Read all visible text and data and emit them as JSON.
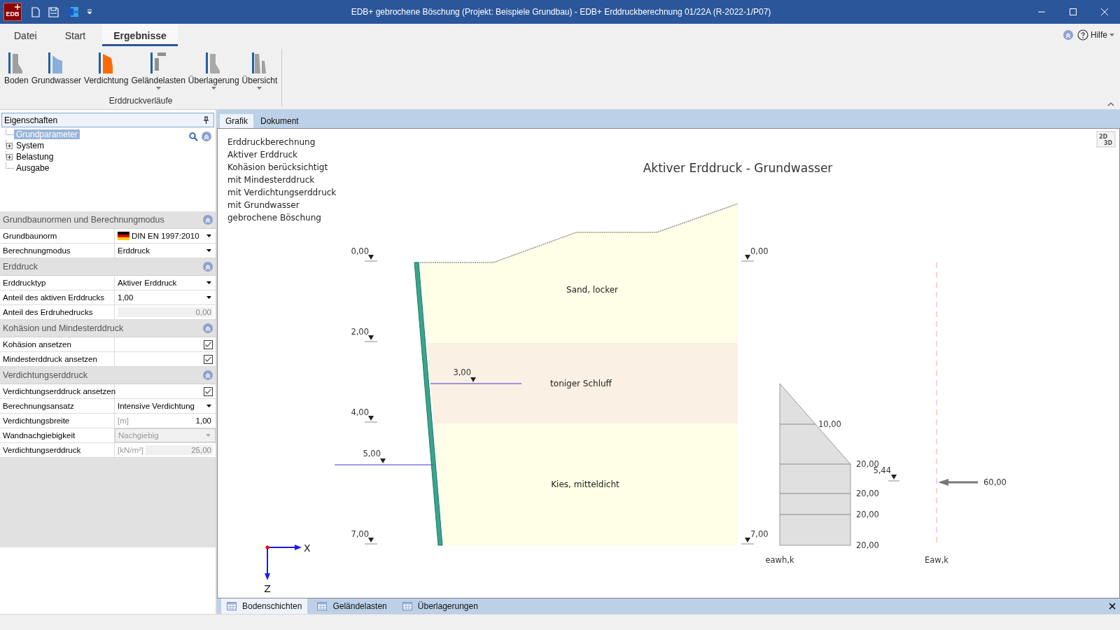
{
  "window": {
    "title": "EDB+ gebrochene Böschung (Projekt: Beispiele Grundbau) - EDB+ Erddruckberechnung 01/22A (R-2022-1/P07)",
    "logo": "EDB"
  },
  "menu_tabs": [
    {
      "label": "Datei",
      "selected": false
    },
    {
      "label": "Start",
      "selected": false
    },
    {
      "label": "Ergebnisse",
      "selected": true
    }
  ],
  "help": {
    "label": "Hilfe"
  },
  "ribbon": {
    "buttons": [
      {
        "label": "Boden",
        "dropdown": false
      },
      {
        "label": "Grundwasser",
        "dropdown": false
      },
      {
        "label": "Verdichtung",
        "dropdown": false
      },
      {
        "label": "Geländelasten",
        "dropdown": true
      },
      {
        "label": "Überlagerung",
        "dropdown": true
      },
      {
        "label": "Übersicht",
        "dropdown": true
      }
    ],
    "group": "Erddruckverläufe"
  },
  "properties": {
    "title": "Eigenschaften",
    "tree": [
      {
        "label": "Grundparameter",
        "selected": true,
        "kind": "leaf"
      },
      {
        "label": "System",
        "selected": false,
        "kind": "collapsed"
      },
      {
        "label": "Belastung",
        "selected": false,
        "kind": "collapsed"
      },
      {
        "label": "Ausgabe",
        "selected": false,
        "kind": "leaf"
      }
    ],
    "sections": [
      {
        "title": "Grundbaunormen und Berechnungmodus",
        "rows": [
          {
            "label": "Grundbaunorm",
            "kind": "flag_dropdown",
            "value": "DIN EN 1997:2010",
            "disabled": false
          },
          {
            "label": "Berechnungmodus",
            "kind": "dropdown",
            "value": "Erddruck",
            "disabled": false
          }
        ]
      },
      {
        "title": "Erddruck",
        "rows": [
          {
            "label": "Erddrucktyp",
            "kind": "dropdown",
            "value": "Aktiver Erddruck",
            "disabled": false
          },
          {
            "label": "Anteil des aktiven Erddrucks",
            "kind": "dropdown",
            "value": "1,00",
            "disabled": false
          },
          {
            "label": "Anteil des Erdruhedrucks",
            "kind": "number",
            "value": "0,00",
            "disabled": true
          }
        ]
      },
      {
        "title": "Kohäsion und Mindesterddruck",
        "rows": [
          {
            "label": "Kohäsion ansetzen",
            "kind": "checkbox",
            "checked": true
          },
          {
            "label": "Mindesterddruck ansetzen",
            "kind": "checkbox",
            "checked": true
          }
        ]
      },
      {
        "title": "Verdichtungserddruck",
        "rows": [
          {
            "label": "Verdichtungserddruck ansetzen",
            "kind": "checkbox",
            "checked": true
          },
          {
            "label": "Berechnungsansatz",
            "kind": "dropdown",
            "value": "Intensive Verdichtung",
            "disabled": false
          },
          {
            "label": "Verdichtungsbreite",
            "kind": "number",
            "unit": "[m]",
            "value": "1,00",
            "disabled": false
          },
          {
            "label": "Wandnachgiebigkeit",
            "kind": "dropdown",
            "value": "Nachgiebig",
            "disabled": true
          },
          {
            "label": "Verdichtungserddruck",
            "kind": "number",
            "unit": "[kN/m²]",
            "value": "25,00",
            "disabled": true
          }
        ]
      }
    ]
  },
  "view_tabs": [
    {
      "label": "Grafik",
      "selected": true
    },
    {
      "label": "Dokument",
      "selected": false
    }
  ],
  "graphic": {
    "view_mode": [
      "2D",
      "3D"
    ],
    "info_lines": [
      "Erddruckberechnung",
      "Aktiver Erddruck",
      "Kohäsion berücksichtigt",
      "mit Mindesterddruck",
      "mit Verdichtungserddruck",
      "mit Grundwasser",
      "gebrochene Böschung"
    ],
    "title": "Aktiver Erddruck - Grundwasser",
    "layers": [
      {
        "name": "Sand, locker",
        "color": "#fffee6"
      },
      {
        "name": "toniger Schluff",
        "color": "#faf0e3"
      },
      {
        "name": "Kies, mitteldicht",
        "color": "#fffee6"
      }
    ],
    "left_levels": [
      "0,00",
      "2,00",
      "4,00",
      "7,00"
    ],
    "right_levels": [
      "0,00",
      "7,00"
    ],
    "water_levels": [
      "3,00",
      "5,00"
    ],
    "pressure_values": [
      "10,00",
      "20,00",
      "20,00",
      "20,00",
      "20,00"
    ],
    "resultant_level": "5,44",
    "force_value": "60,00",
    "diagram_labels": [
      "eawh,k",
      "Eaw,k"
    ],
    "axes": [
      "X",
      "Z"
    ]
  },
  "bottom_tabs": [
    {
      "label": "Bodenschichten",
      "selected": true
    },
    {
      "label": "Geländelasten",
      "selected": false
    },
    {
      "label": "Überlagerungen",
      "selected": false
    }
  ]
}
